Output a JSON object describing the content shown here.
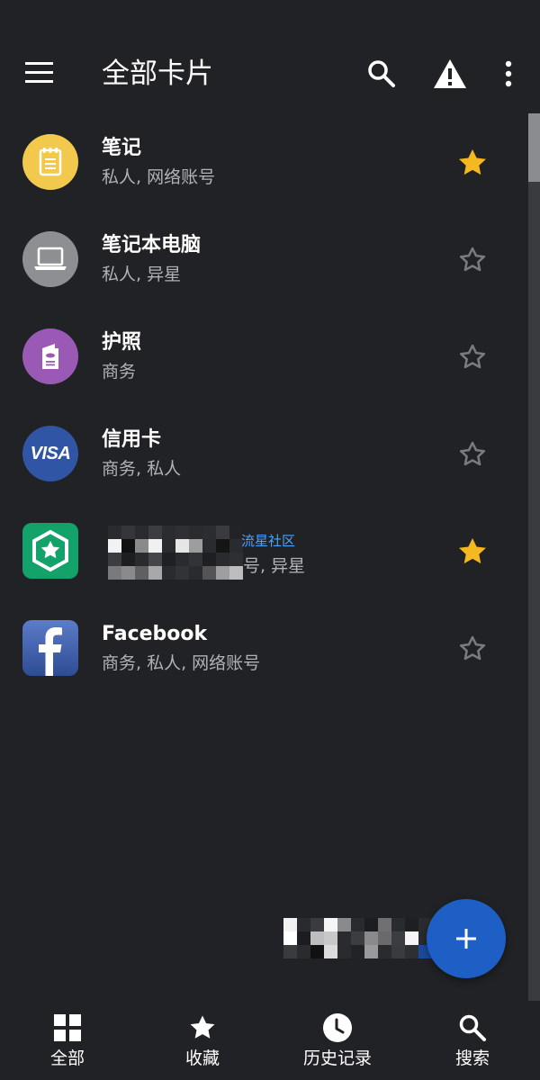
{
  "appbar": {
    "title": "全部卡片",
    "menu_icon": "menu-icon",
    "search_icon": "search-icon",
    "warning_icon": "warning-icon",
    "more_icon": "more-vert-icon"
  },
  "colors": {
    "background": "#212225",
    "star_active": "#f5b820",
    "star_inactive": "#7a7b7f",
    "fab": "#1e5fc6",
    "link": "#4aa3ff"
  },
  "cards": [
    {
      "name": "笔记",
      "tags": "私人, 网络账号",
      "icon": "notepad-icon",
      "avatar_color": "#f2c94c",
      "favorite": true
    },
    {
      "name": "笔记本电脑",
      "tags": "私人, 异星",
      "icon": "laptop-icon",
      "avatar_color": "#8e8f93",
      "favorite": false
    },
    {
      "name": "护照",
      "tags": "商务",
      "icon": "passport-icon",
      "avatar_color": "#9b59b6",
      "favorite": false
    },
    {
      "name": "信用卡",
      "tags": "商务, 私人",
      "icon": "visa-icon",
      "avatar_color": "#2f55a4",
      "favorite": false
    },
    {
      "name": "",
      "tags": "号, 异星",
      "link": "流星社区",
      "icon": "hexagon-star-icon",
      "avatar_color": "#13a26a",
      "favorite": true
    },
    {
      "name": "Facebook",
      "tags": "商务, 私人, 网络账号",
      "icon": "facebook-icon",
      "avatar_color": "#3b5998",
      "favorite": false
    }
  ],
  "visa_text": "VISA",
  "fab": {
    "icon": "plus-icon"
  },
  "bottom_nav": [
    {
      "label": "全部",
      "icon": "grid-icon"
    },
    {
      "label": "收藏",
      "icon": "star-icon"
    },
    {
      "label": "历史记录",
      "icon": "clock-icon"
    },
    {
      "label": "搜索",
      "icon": "search-icon"
    }
  ]
}
